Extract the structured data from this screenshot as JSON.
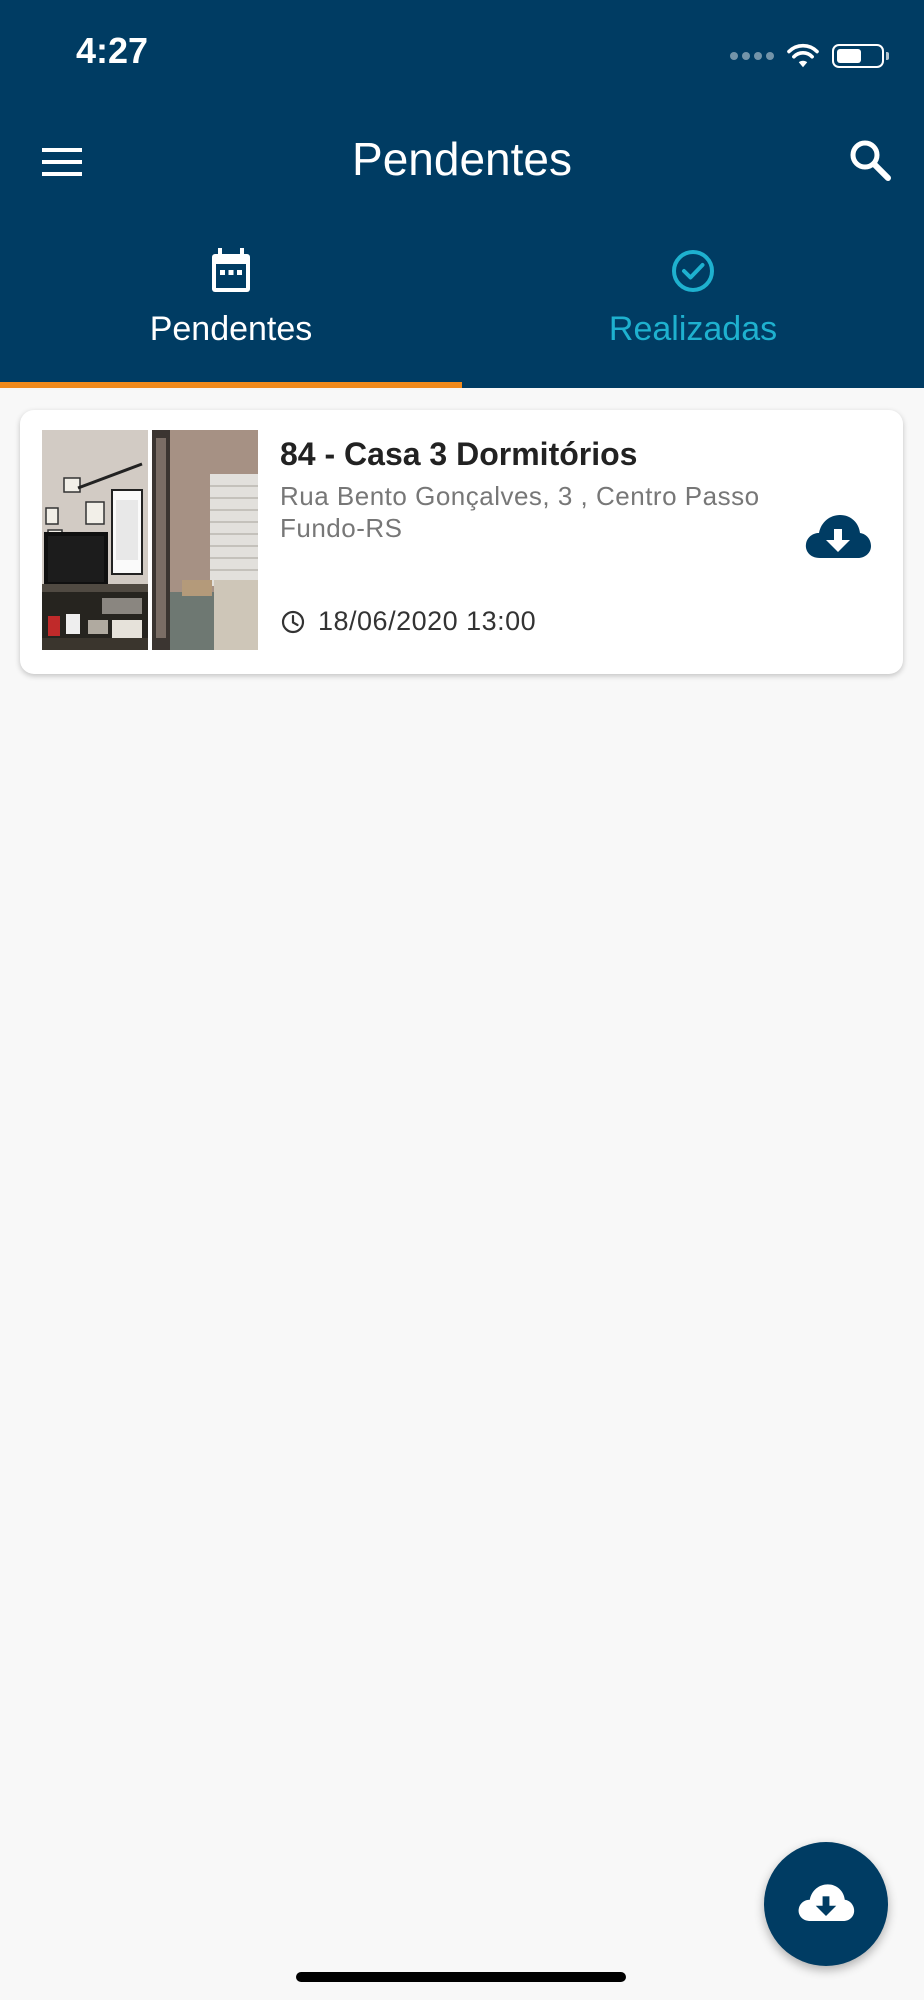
{
  "status": {
    "time": "4:27"
  },
  "header": {
    "title": "Pendentes"
  },
  "tabs": [
    {
      "label": "Pendentes",
      "icon": "calendar-icon",
      "active": true
    },
    {
      "label": "Realizadas",
      "icon": "check-circle-icon",
      "active": false
    }
  ],
  "card": {
    "title": "84 - Casa 3 Dormitórios",
    "address": "Rua Bento Gonçalves, 3 , Centro Passo Fundo-RS",
    "datetime": "18/06/2020 13:00",
    "download_icon": "cloud-download-icon"
  },
  "fab": {
    "icon": "cloud-download-icon"
  },
  "colors": {
    "primary": "#003c63",
    "accent": "#f08a1c",
    "tab_inactive": "#1eb1cf",
    "background": "#f8f8f8"
  }
}
